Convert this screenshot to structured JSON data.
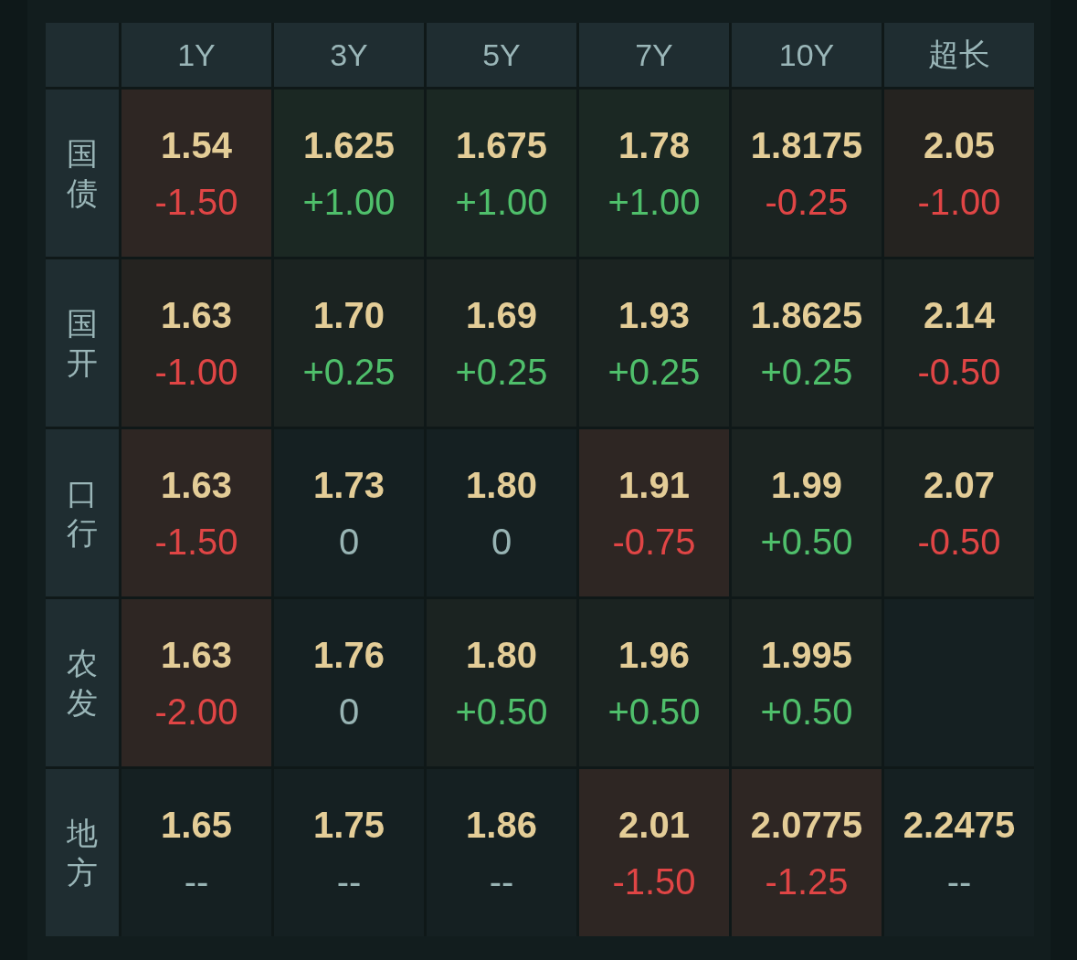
{
  "columns": [
    "1Y",
    "3Y",
    "5Y",
    "7Y",
    "10Y",
    "超长"
  ],
  "rows": [
    {
      "label": "国债",
      "cells": [
        {
          "rate": "1.54",
          "change": "-1.50",
          "color": "#e04545",
          "kind": "down"
        },
        {
          "rate": "1.625",
          "change": "+1.00",
          "color": "#4fbf6b",
          "kind": "up"
        },
        {
          "rate": "1.675",
          "change": "+1.00",
          "color": "#4fbf6b",
          "kind": "up"
        },
        {
          "rate": "1.78",
          "change": "+1.00",
          "color": "#4fbf6b",
          "kind": "up"
        },
        {
          "rate": "1.8175",
          "change": "-0.25",
          "color": "#e04545",
          "kind": "mild"
        },
        {
          "rate": "2.05",
          "change": "-1.00",
          "color": "#e04545",
          "kind": "warm"
        }
      ]
    },
    {
      "label": "国开",
      "cells": [
        {
          "rate": "1.63",
          "change": "-1.00",
          "color": "#e04545",
          "kind": "warm"
        },
        {
          "rate": "1.70",
          "change": "+0.25",
          "color": "#4fbf6b",
          "kind": "mild"
        },
        {
          "rate": "1.69",
          "change": "+0.25",
          "color": "#4fbf6b",
          "kind": "mild"
        },
        {
          "rate": "1.93",
          "change": "+0.25",
          "color": "#4fbf6b",
          "kind": "mild"
        },
        {
          "rate": "1.8625",
          "change": "+0.25",
          "color": "#4fbf6b",
          "kind": "mild"
        },
        {
          "rate": "2.14",
          "change": "-0.50",
          "color": "#e04545",
          "kind": "mild"
        }
      ]
    },
    {
      "label": "口行",
      "cells": [
        {
          "rate": "1.63",
          "change": "-1.50",
          "color": "#e04545",
          "kind": "down"
        },
        {
          "rate": "1.73",
          "change": "0",
          "color": "#98b4b4",
          "kind": "none"
        },
        {
          "rate": "1.80",
          "change": "0",
          "color": "#98b4b4",
          "kind": "none"
        },
        {
          "rate": "1.91",
          "change": "-0.75",
          "color": "#e04545",
          "kind": "down"
        },
        {
          "rate": "1.99",
          "change": "+0.50",
          "color": "#4fbf6b",
          "kind": "mild"
        },
        {
          "rate": "2.07",
          "change": "-0.50",
          "color": "#e04545",
          "kind": "mild"
        }
      ]
    },
    {
      "label": "农发",
      "cells": [
        {
          "rate": "1.63",
          "change": "-2.00",
          "color": "#e04545",
          "kind": "down"
        },
        {
          "rate": "1.76",
          "change": "0",
          "color": "#98b4b4",
          "kind": "none"
        },
        {
          "rate": "1.80",
          "change": "+0.50",
          "color": "#4fbf6b",
          "kind": "mild"
        },
        {
          "rate": "1.96",
          "change": "+0.50",
          "color": "#4fbf6b",
          "kind": "mild"
        },
        {
          "rate": "1.995",
          "change": "+0.50",
          "color": "#4fbf6b",
          "kind": "mild"
        },
        {
          "kind": "none"
        }
      ]
    },
    {
      "label": "地方",
      "cells": [
        {
          "rate": "1.65",
          "change": "--",
          "color": "#98b4b4",
          "kind": "none"
        },
        {
          "rate": "1.75",
          "change": "--",
          "color": "#98b4b4",
          "kind": "none"
        },
        {
          "rate": "1.86",
          "change": "--",
          "color": "#98b4b4",
          "kind": "none"
        },
        {
          "rate": "2.01",
          "change": "-1.50",
          "color": "#e04545",
          "kind": "down"
        },
        {
          "rate": "2.0775",
          "change": "-1.25",
          "color": "#e04545",
          "kind": "down"
        },
        {
          "rate": "2.2475",
          "change": "--",
          "color": "#98b4b4",
          "kind": "none"
        }
      ]
    }
  ]
}
